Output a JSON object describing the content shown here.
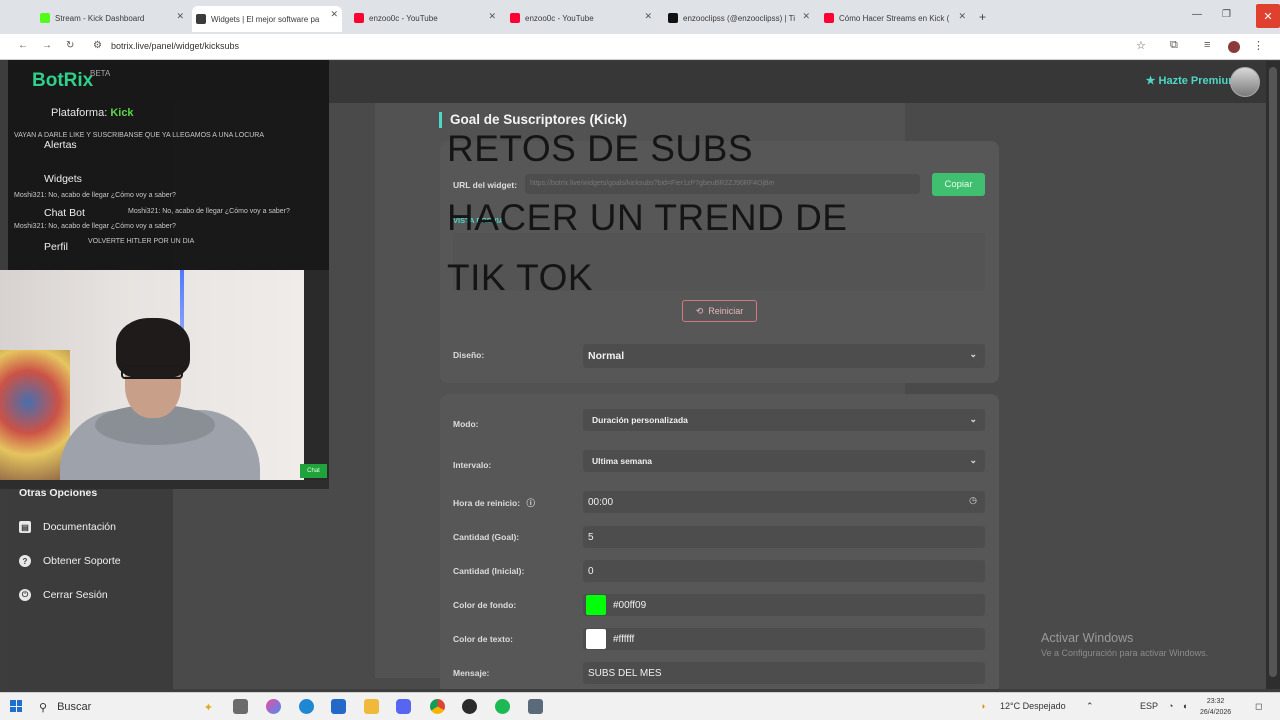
{
  "browser": {
    "tabs": [
      {
        "label": "Stream - Kick Dashboard",
        "color": "#53fc18"
      },
      {
        "label": "Widgets | El mejor software pa",
        "color": "#3b3b3b"
      },
      {
        "label": "enzoo0c - YouTube",
        "color": "#ff0033"
      },
      {
        "label": "enzoo0c - YouTube",
        "color": "#ff0033"
      },
      {
        "label": "enzooclipss (@enzooclipss) | Ti",
        "color": "#111111"
      },
      {
        "label": "Cómo Hacer Streams en Kick (",
        "color": "#ff0033"
      }
    ],
    "url": "botrix.live/panel/widget/kicksubs"
  },
  "header": {
    "premium_label": "Hazte Premium"
  },
  "chat_overlay": {
    "logo": "BotRix",
    "beta": "BETA",
    "platform_label": "Plataforma:",
    "platform_value": "Kick",
    "nav": [
      "Alertas",
      "Widgets",
      "Chat Bot",
      "Perfil"
    ],
    "lines": [
      "VAYAN A DARLE LIKE Y SUSCRIBANSE QUE YA LLEGAMOS A UNA LOCURA",
      "Moshi321: No, acabo de llegar ¿Cómo voy a saber?",
      "Moshi321: No, acabo de llegar ¿Cómo voy a saber?",
      "Moshi321: No, acabo de llegar ¿Cómo voy a saber?",
      "VOLVERTE HITLER POR UN DIA"
    ],
    "chat_button": "Chat"
  },
  "sidebar": {
    "section_title": "Otras Opciones",
    "items": [
      {
        "label": "Documentación",
        "icon": "book-icon"
      },
      {
        "label": "Obtener Soporte",
        "icon": "help-icon"
      },
      {
        "label": "Cerrar Sesión",
        "icon": "logout-icon"
      }
    ]
  },
  "overlay_text": {
    "line1": "RETOS DE SUBS",
    "line2": "HACER UN TREND DE",
    "line3": "TIK TOK"
  },
  "widget": {
    "title": "Goal de Suscriptores (Kick)",
    "url_label": "URL del widget:",
    "copy_button": "Copiar",
    "preview_label": "VISTA PREVIA",
    "reset_button": "Reiniciar",
    "design_label": "Diseño:",
    "design_value": "Normal",
    "mode_label": "Modo:",
    "mode_value": "Duración personalizada",
    "interval_label": "Intervalo:",
    "interval_value": "Ultima semana",
    "reset_time_label": "Hora de reinicio:",
    "reset_time_value": "00:00",
    "goal_label": "Cantidad (Goal):",
    "goal_value": "5",
    "initial_label": "Cantidad (Inicial):",
    "initial_value": "0",
    "bg_color_label": "Color de fondo:",
    "bg_color_value": "#00ff09",
    "text_color_label": "Color de texto:",
    "text_color_value": "#ffffff",
    "message_label": "Mensaje:",
    "message_value": "SUBS DEL MES"
  },
  "watermark": {
    "line1": "Activar Windows",
    "line2": "Ve a Configuración para activar Windows."
  },
  "taskbar": {
    "search_placeholder": "Buscar",
    "weather": "12°C Despejado",
    "lang": "ESP",
    "time": "23:32",
    "date": "26/4/2026"
  },
  "colors": {
    "accent": "#4fd6c6",
    "copy_button": "#3fbf6f",
    "brand": "#2fd08a"
  }
}
